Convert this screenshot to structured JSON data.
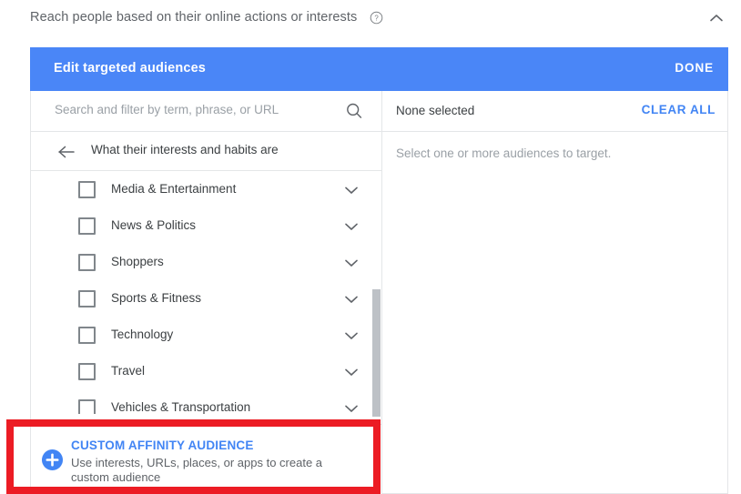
{
  "section": {
    "title": "Reach people based on their online actions or interests",
    "help_icon": "help-circle-icon",
    "collapse_icon": "chevron-up-icon"
  },
  "edit_bar": {
    "title": "Edit targeted audiences",
    "done_label": "DONE",
    "background_color": "#4a86f7"
  },
  "left_pane": {
    "search": {
      "placeholder": "Search and filter by term, phrase, or URL",
      "value": "",
      "icon": "search-icon"
    },
    "breadcrumb": {
      "back_icon": "arrow-left-icon",
      "label": "What their interests and habits are"
    },
    "categories": [
      {
        "label": "Media & Entertainment",
        "checked": false,
        "expand_icon": "chevron-down-icon"
      },
      {
        "label": "News & Politics",
        "checked": false,
        "expand_icon": "chevron-down-icon"
      },
      {
        "label": "Shoppers",
        "checked": false,
        "expand_icon": "chevron-down-icon"
      },
      {
        "label": "Sports & Fitness",
        "checked": false,
        "expand_icon": "chevron-down-icon"
      },
      {
        "label": "Technology",
        "checked": false,
        "expand_icon": "chevron-down-icon"
      },
      {
        "label": "Travel",
        "checked": false,
        "expand_icon": "chevron-down-icon"
      },
      {
        "label": "Vehicles & Transportation",
        "checked": false,
        "expand_icon": "chevron-down-icon"
      }
    ],
    "custom_affinity": {
      "icon": "plus-circle-icon",
      "title": "CUSTOM AFFINITY AUDIENCE",
      "description": "Use interests, URLs, places, or apps to create a custom audience",
      "link_color": "#4285f4"
    }
  },
  "right_pane": {
    "selection_count": "None selected",
    "clear_all_label": "CLEAR ALL",
    "empty_state": "Select one or more audiences to target."
  },
  "annotation": {
    "highlight_color": "#ec1c24"
  }
}
